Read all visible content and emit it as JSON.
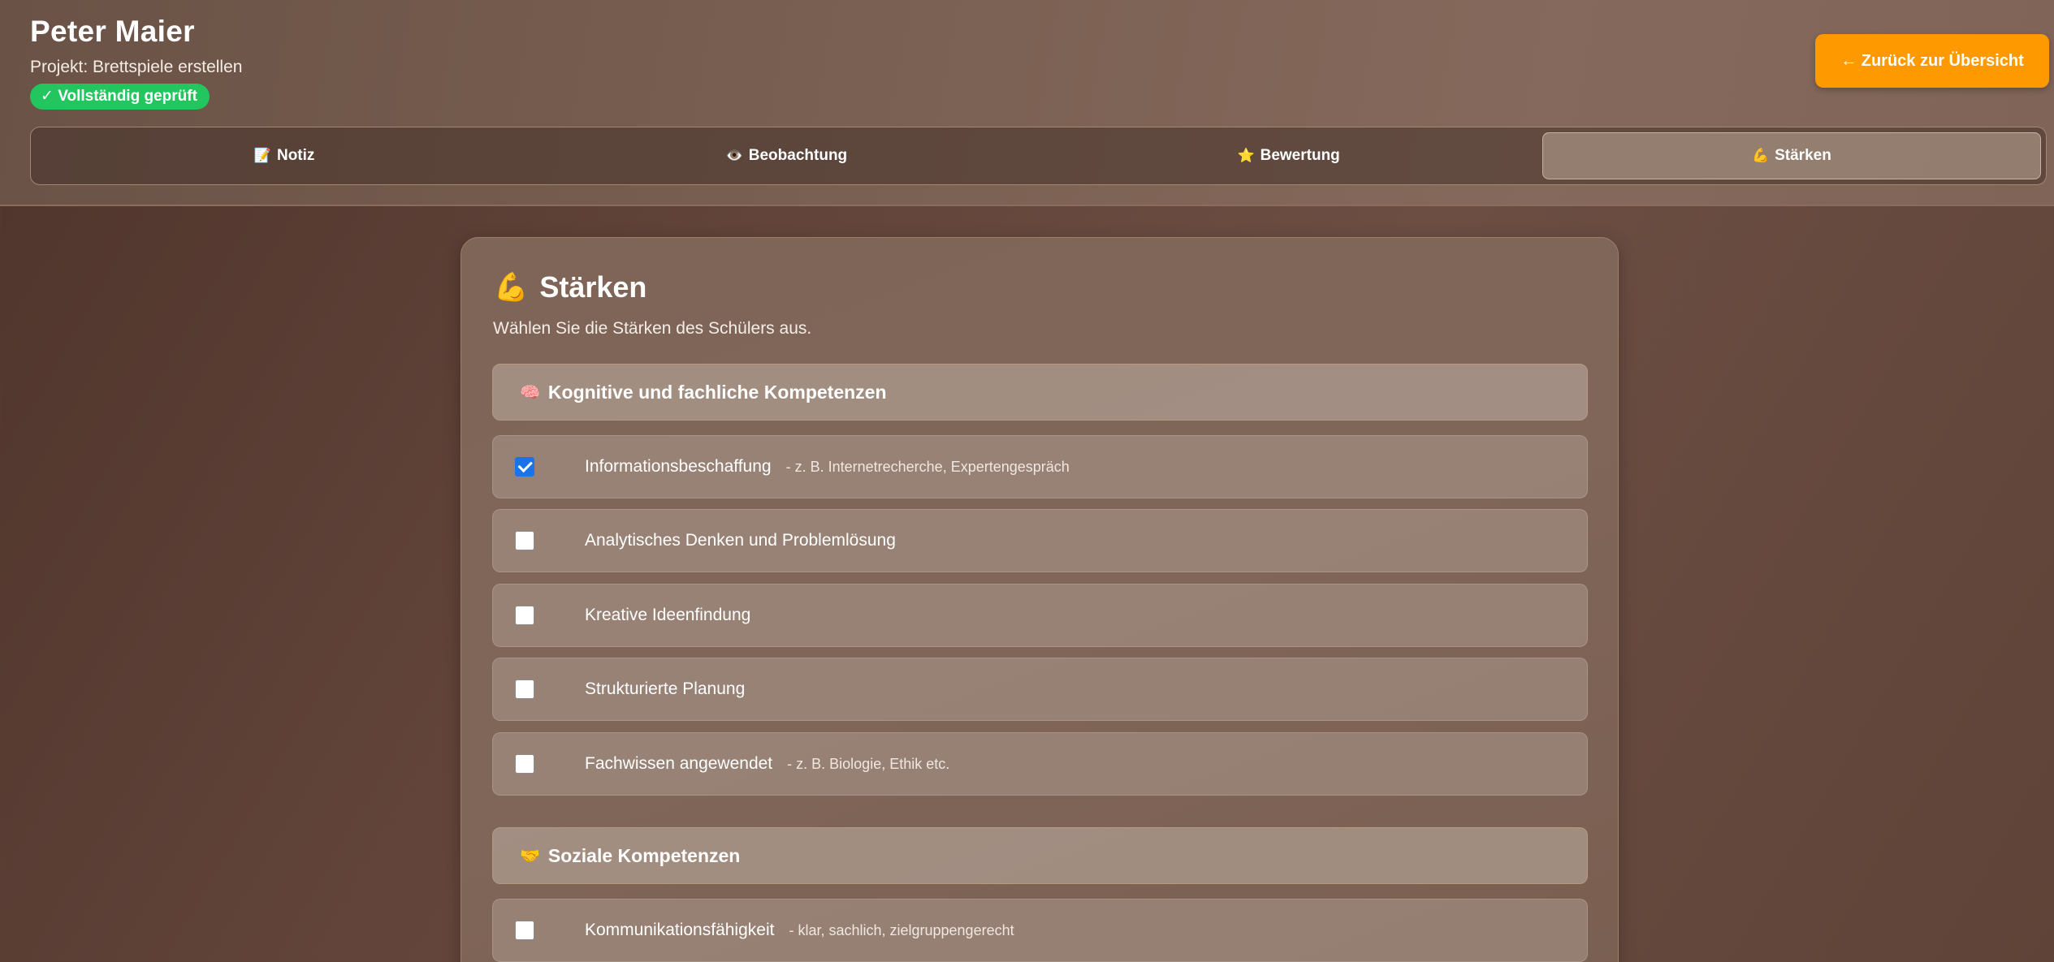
{
  "student": {
    "name": "Peter Maier",
    "project": "Projekt: Brettspiele erstellen",
    "status": "✓ Vollständig geprüft"
  },
  "header": {
    "back_button": "← Zurück zur Übersicht"
  },
  "tabs": [
    {
      "icon": "📝",
      "icon_name": "memo-icon",
      "label": "Notiz",
      "active": false
    },
    {
      "icon": "👁️",
      "icon_name": "eye-icon",
      "label": "Beobachtung",
      "active": false
    },
    {
      "icon": "⭐",
      "icon_name": "star-icon",
      "label": "Bewertung",
      "active": false
    },
    {
      "icon": "💪",
      "icon_name": "flexed-biceps-icon",
      "label": "Stärken",
      "active": true
    }
  ],
  "card": {
    "icon": "💪",
    "title": "Stärken",
    "subtitle": "Wählen Sie die Stärken des Schülers aus."
  },
  "sections": [
    {
      "icon": "🧠",
      "title": "Kognitive und fachliche Kompetenzen",
      "items": [
        {
          "label": "Informationsbeschaffung",
          "hint": "- z. B. Internetrecherche, Expertengespräch",
          "checked": true
        },
        {
          "label": "Analytisches Denken und Problemlösung",
          "hint": "",
          "checked": false
        },
        {
          "label": "Kreative Ideenfindung",
          "hint": "",
          "checked": false
        },
        {
          "label": "Strukturierte Planung",
          "hint": "",
          "checked": false
        },
        {
          "label": "Fachwissen angewendet",
          "hint": "- z. B. Biologie, Ethik etc.",
          "checked": false
        }
      ]
    },
    {
      "icon": "🤝",
      "title": "Soziale Kompetenzen",
      "items": [
        {
          "label": "Kommunikationsfähigkeit",
          "hint": "- klar, sachlich, zielgruppengerecht",
          "checked": false
        }
      ]
    }
  ],
  "colors": {
    "accent_button": "#ff9900",
    "status_badge": "#22c55e",
    "checkbox_checked": "#1a73e8"
  }
}
